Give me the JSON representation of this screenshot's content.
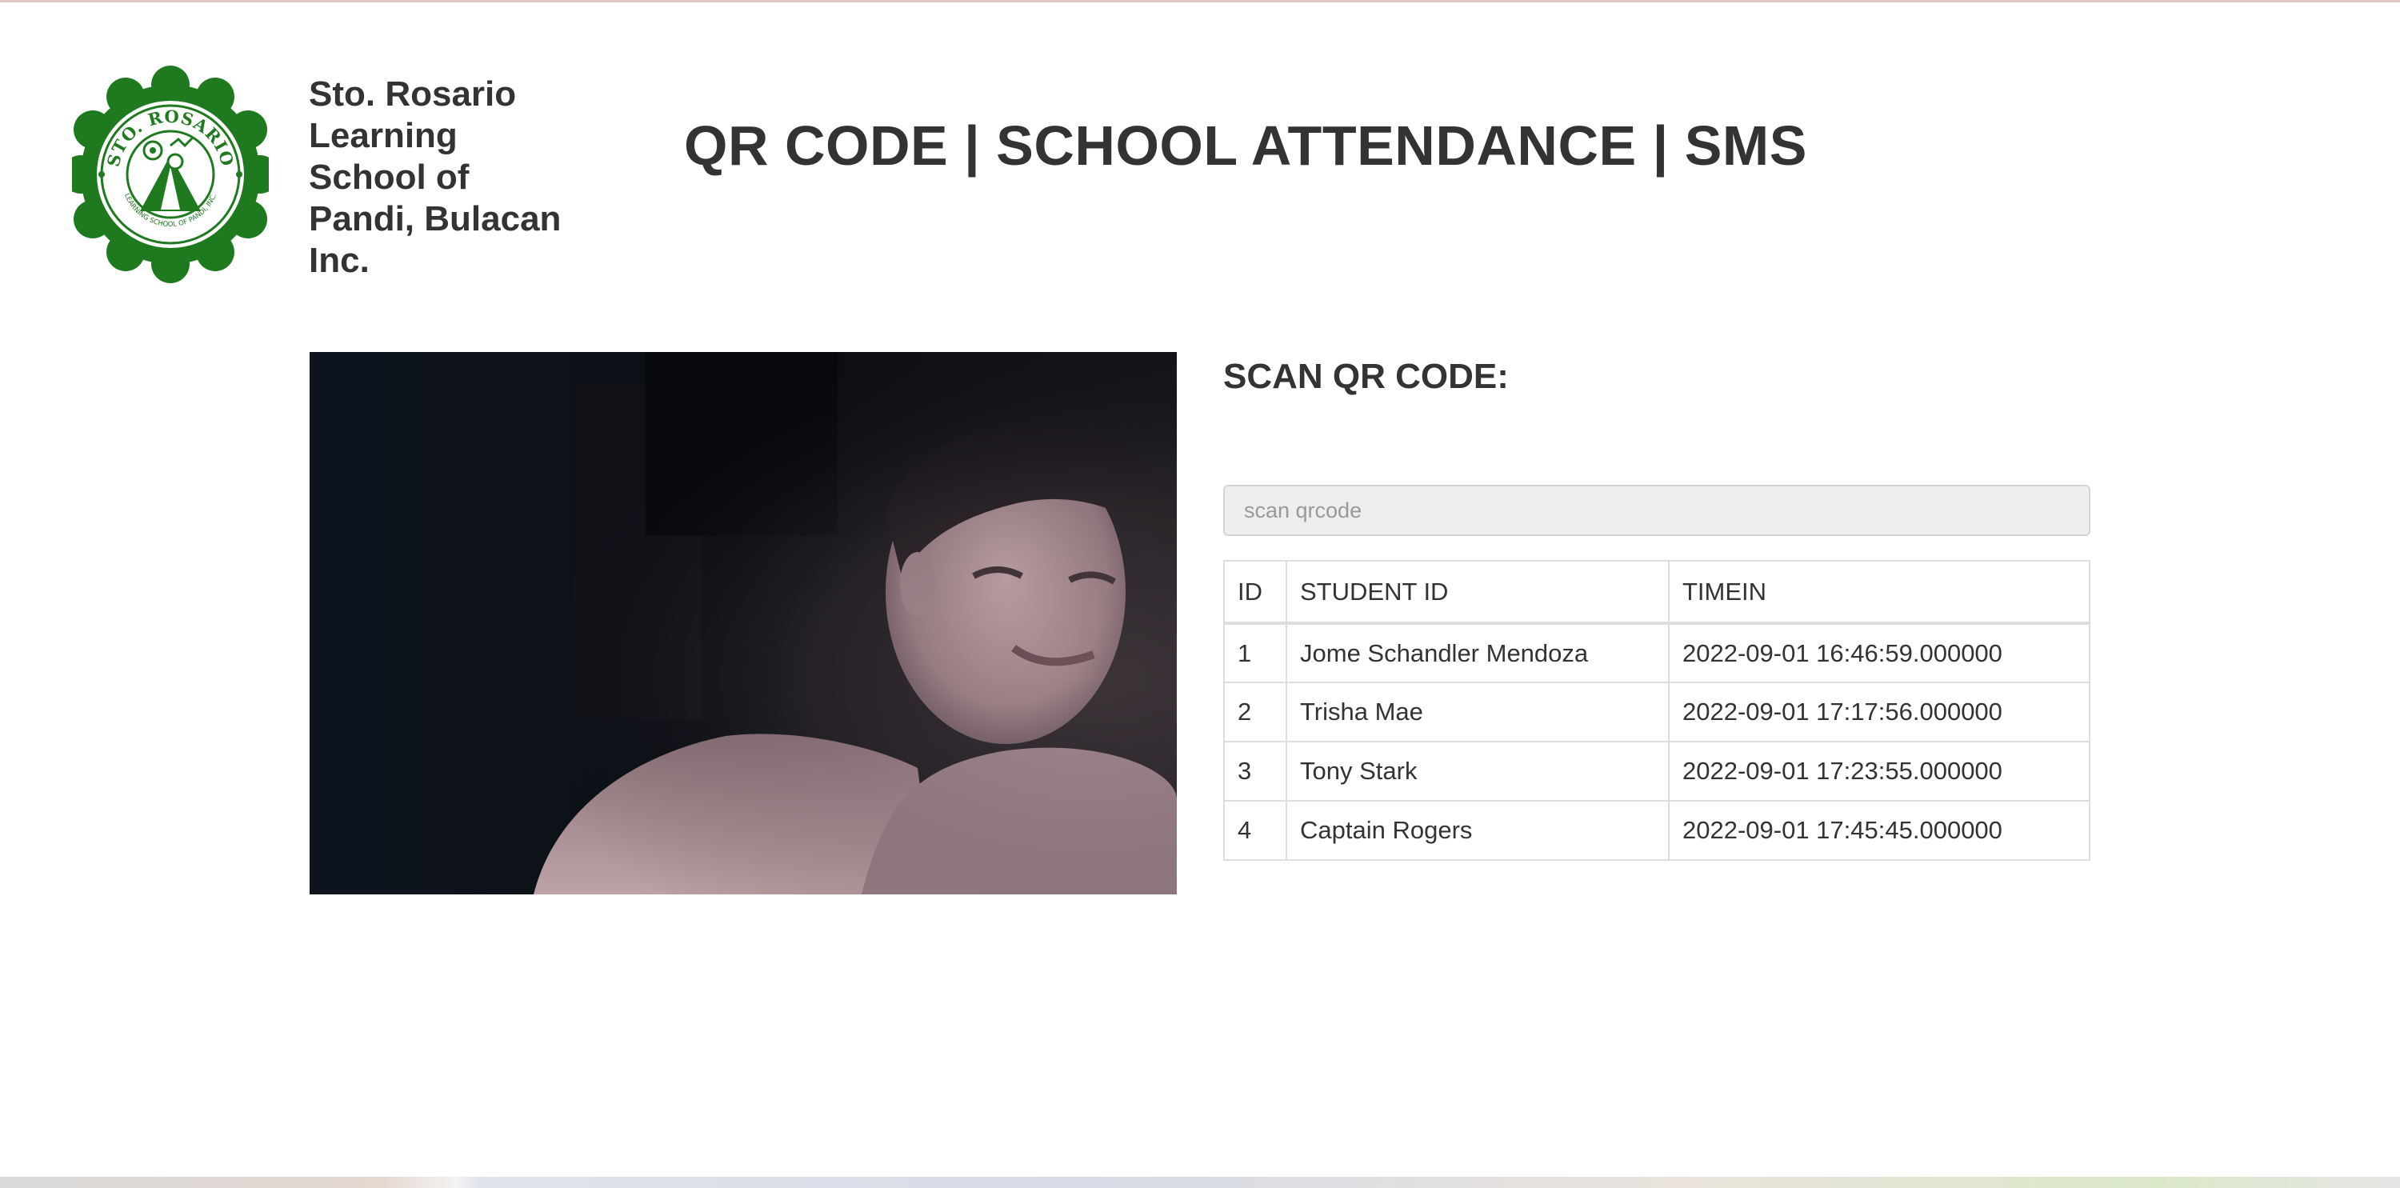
{
  "header": {
    "logo_text_top": "STO. ROSARIO",
    "logo_text_bottom": "LEARNING SCHOOL OF PANDI, INC.",
    "school_name": "Sto. Rosario\nLearning\nSchool of\nPandi, Bulacan\nInc.",
    "title": "QR CODE | SCHOOL ATTENDANCE | SMS"
  },
  "scanner": {
    "heading": "SCAN QR CODE:",
    "input_placeholder": "scan qrcode",
    "input_value": ""
  },
  "table": {
    "headers": [
      "ID",
      "STUDENT ID",
      "TIMEIN"
    ],
    "rows": [
      {
        "id": "1",
        "student": "Jome Schandler Mendoza",
        "timein": "2022-09-01 16:46:59.000000"
      },
      {
        "id": "2",
        "student": "Trisha Mae",
        "timein": "2022-09-01 17:17:56.000000"
      },
      {
        "id": "3",
        "student": "Tony Stark",
        "timein": "2022-09-01 17:23:55.000000"
      },
      {
        "id": "4",
        "student": "Captain Rogers",
        "timein": "2022-09-01 17:45:45.000000"
      }
    ]
  },
  "colors": {
    "logo_green": "#1f7a1f",
    "text": "#333333",
    "border": "#dddddd",
    "input_bg": "#eeeeee"
  }
}
